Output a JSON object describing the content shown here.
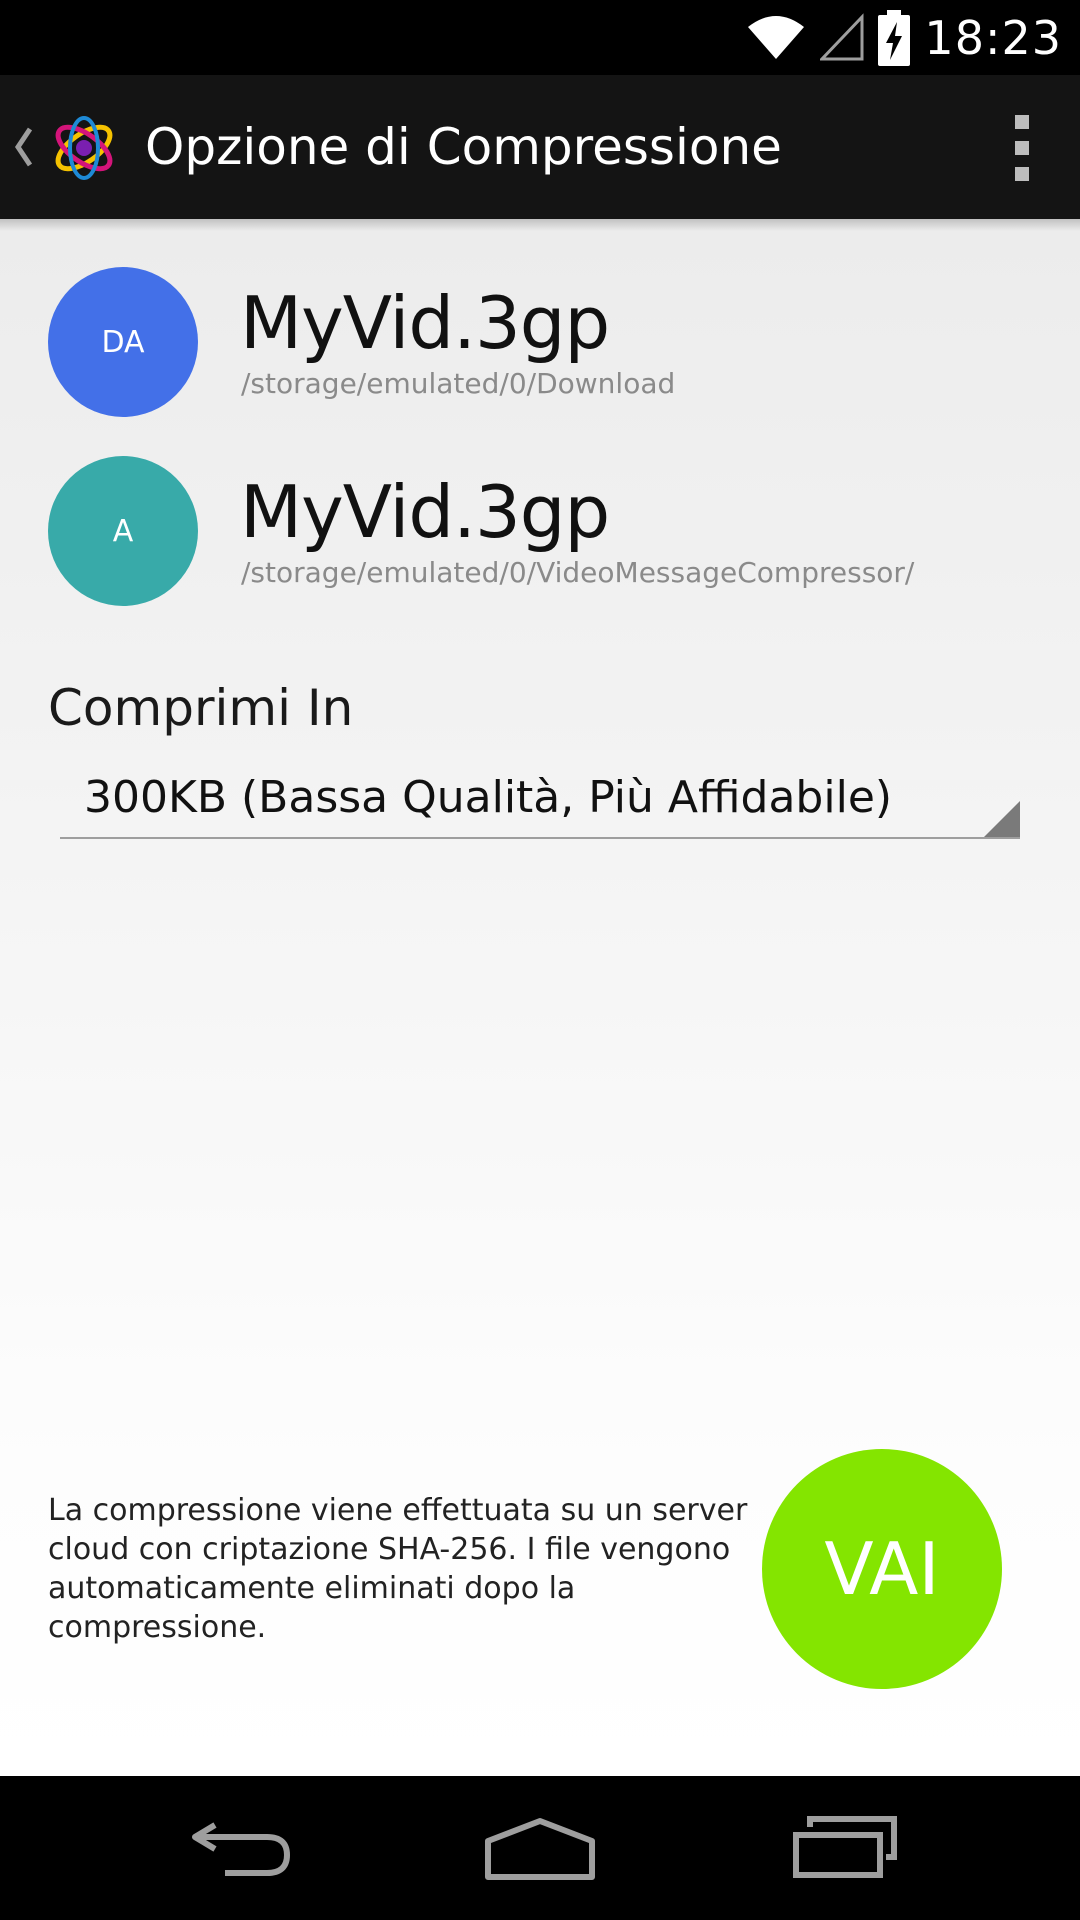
{
  "status_bar": {
    "time": "18:23",
    "icons": [
      "wifi-icon",
      "signal-icon",
      "battery-charging-icon"
    ]
  },
  "action_bar": {
    "title": "Opzione di Compressione",
    "icons": [
      "back-caret-icon",
      "app-logo-icon",
      "overflow-menu-icon"
    ]
  },
  "files": [
    {
      "badge": "DA",
      "badge_color": "#4370e8",
      "name": "MyVid.3gp",
      "path": "/storage/emulated/0/Download"
    },
    {
      "badge": "A",
      "badge_color": "#38aaa9",
      "name": "MyVid.3gp",
      "path": "/storage/emulated/0/VideoMessageCompressor/"
    }
  ],
  "compress": {
    "label": "Comprimi In",
    "selected_option": "300KB (Bassa Qualità, Più Affidabile)"
  },
  "info": {
    "text": "La compressione viene effettuata su un server cloud con criptazione SHA-256. I file vengono automaticamente eliminati dopo la compressione."
  },
  "go_button": {
    "label": "VAI",
    "color": "#84e500"
  },
  "nav_bar": {
    "icons": [
      "back-icon",
      "home-icon",
      "recent-apps-icon"
    ]
  }
}
